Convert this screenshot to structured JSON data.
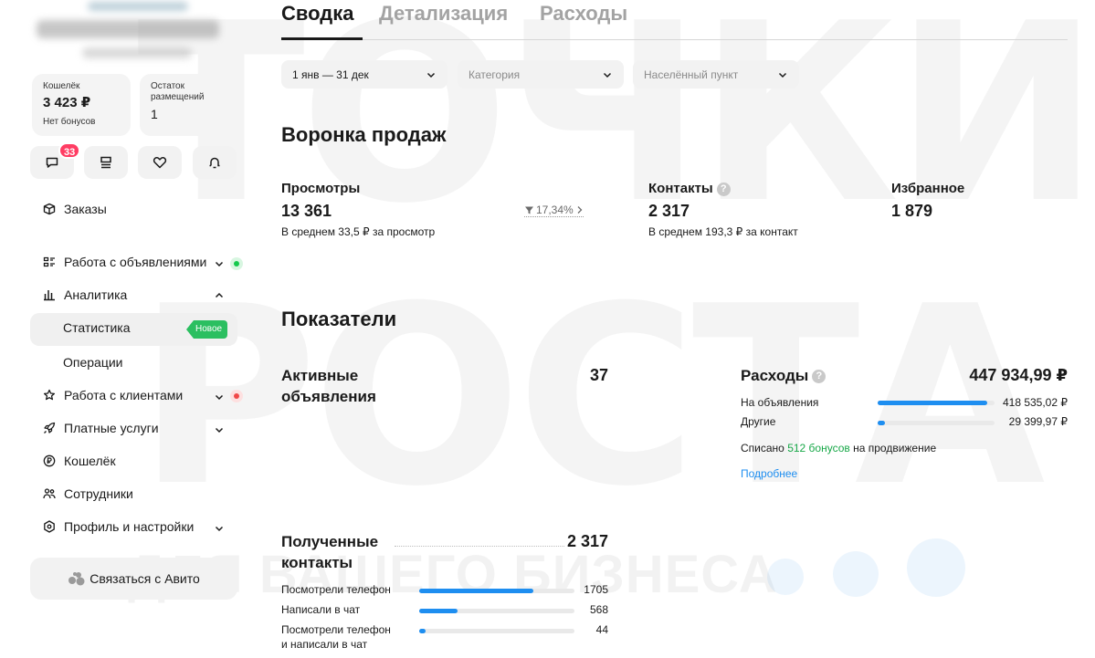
{
  "watermark": {
    "line1": "ТОЧКИ",
    "line2": "РОСТА",
    "line3": "ДЛЯ ВАШЕГО БИЗНЕСА"
  },
  "sidebar": {
    "wallet": {
      "label": "Кошелёк",
      "amount": "3 423 ₽",
      "sub": "Нет бонусов"
    },
    "remain": {
      "label": "Остаток размещений",
      "value": "1"
    },
    "messages_badge": "33",
    "nav": {
      "orders": "Заказы",
      "ads": "Работа с объявлениями",
      "analytics": "Аналитика",
      "statistics": "Статистика",
      "new_tag": "Новое",
      "operations": "Операции",
      "clients": "Работа с клиентами",
      "paid": "Платные услуги",
      "wallet": "Кошелёк",
      "staff": "Сотрудники",
      "profile": "Профиль и настройки"
    },
    "contact_button": "Связаться с Авито"
  },
  "tabs": {
    "summary": "Сводка",
    "details": "Детализация",
    "expenses": "Расходы"
  },
  "filters": {
    "period": "1 янв — 31 дек",
    "category": "Категория",
    "city": "Населённый пункт"
  },
  "funnel": {
    "title": "Воронка продаж",
    "views": {
      "label": "Просмотры",
      "value": "13 361",
      "note": "В среднем 33,5 ₽ за просмотр",
      "conversion": "17,34%"
    },
    "contacts": {
      "label": "Контакты",
      "value": "2 317",
      "note": "В среднем 193,3 ₽ за контакт"
    },
    "favorites": {
      "label": "Избранное",
      "value": "1 879"
    }
  },
  "metrics": {
    "title": "Показатели",
    "active_ads": {
      "label_line1": "Активные",
      "label_line2": "объявления",
      "value": "37"
    },
    "expenses": {
      "label": "Расходы",
      "total": "447 934,99 ₽",
      "rows": [
        {
          "label": "На объявления",
          "value": "418 535,02 ₽",
          "share": 0.934
        },
        {
          "label": "Другие",
          "value": "29 399,97 ₽",
          "share": 0.066
        }
      ],
      "bonus_prefix": "Списано",
      "bonus_amount": "512 бонусов",
      "bonus_suffix": "на продвижение",
      "more_link": "Подробнее"
    },
    "received": {
      "label_line1": "Полученные",
      "label_line2": "контакты",
      "value": "2 317",
      "rows": [
        {
          "label": "Посмотрели телефон",
          "value": "1705",
          "share": 0.736
        },
        {
          "label": "Написали в чат",
          "value": "568",
          "share": 0.245
        },
        {
          "label_line1": "Посмотрели телефон",
          "label_line2": "и написали в чат",
          "value": "44",
          "share": 0.019
        }
      ]
    }
  },
  "colors": {
    "accent": "#1e8ef0",
    "green": "#2bbf60",
    "badge": "#ff3d63"
  }
}
